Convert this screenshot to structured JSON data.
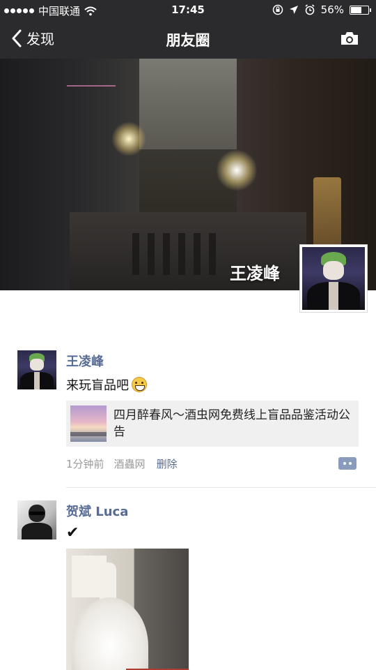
{
  "status": {
    "carrier": "中国联通",
    "time": "17:45",
    "battery": "56%",
    "battery_level": 0.56
  },
  "nav": {
    "back_label": "发现",
    "title": "朋友圈"
  },
  "profile": {
    "name": "王凌峰"
  },
  "posts": [
    {
      "author": "王凌峰",
      "text": "来玩盲品吧",
      "link_title": "四月醉春风～酒虫网免费线上盲品品鉴活动公告",
      "time": "1分钟前",
      "source": "酒蟲网",
      "delete_label": "删除"
    },
    {
      "author": "贺斌 Luca",
      "text": "✔"
    }
  ],
  "icons": {
    "back": "chevron-left-icon",
    "camera": "camera-icon",
    "wifi": "wifi-icon",
    "location": "location-icon",
    "alarm": "alarm-icon",
    "lock": "orientation-lock-icon",
    "more": "comment-more-icon"
  },
  "colors": {
    "link": "#576b95",
    "nav_bg": "#2b2b2d",
    "meta": "#9a9a9a"
  }
}
